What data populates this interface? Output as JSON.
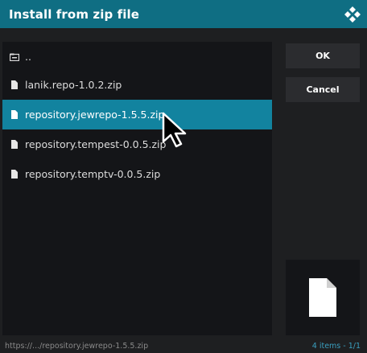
{
  "dialog": {
    "title": "Install from zip file"
  },
  "files": [
    {
      "name": "..",
      "icon": "folder-up-icon"
    },
    {
      "name": "lanik.repo-1.0.2.zip",
      "icon": "file-icon"
    },
    {
      "name": "repository.jewrepo-1.5.5.zip",
      "icon": "file-icon",
      "selected": true
    },
    {
      "name": "repository.tempest-0.0.5.zip",
      "icon": "file-icon"
    },
    {
      "name": "repository.temptv-0.0.5.zip",
      "icon": "file-icon"
    }
  ],
  "buttons": {
    "ok": "OK",
    "cancel": "Cancel"
  },
  "status": {
    "path": "https://.../repository.jewrepo-1.5.5.zip",
    "count": "4 items - 1/1"
  },
  "colors": {
    "titlebar": "#0f6e83",
    "selected_row": "#12839f",
    "count_text": "#3a9fbf"
  }
}
